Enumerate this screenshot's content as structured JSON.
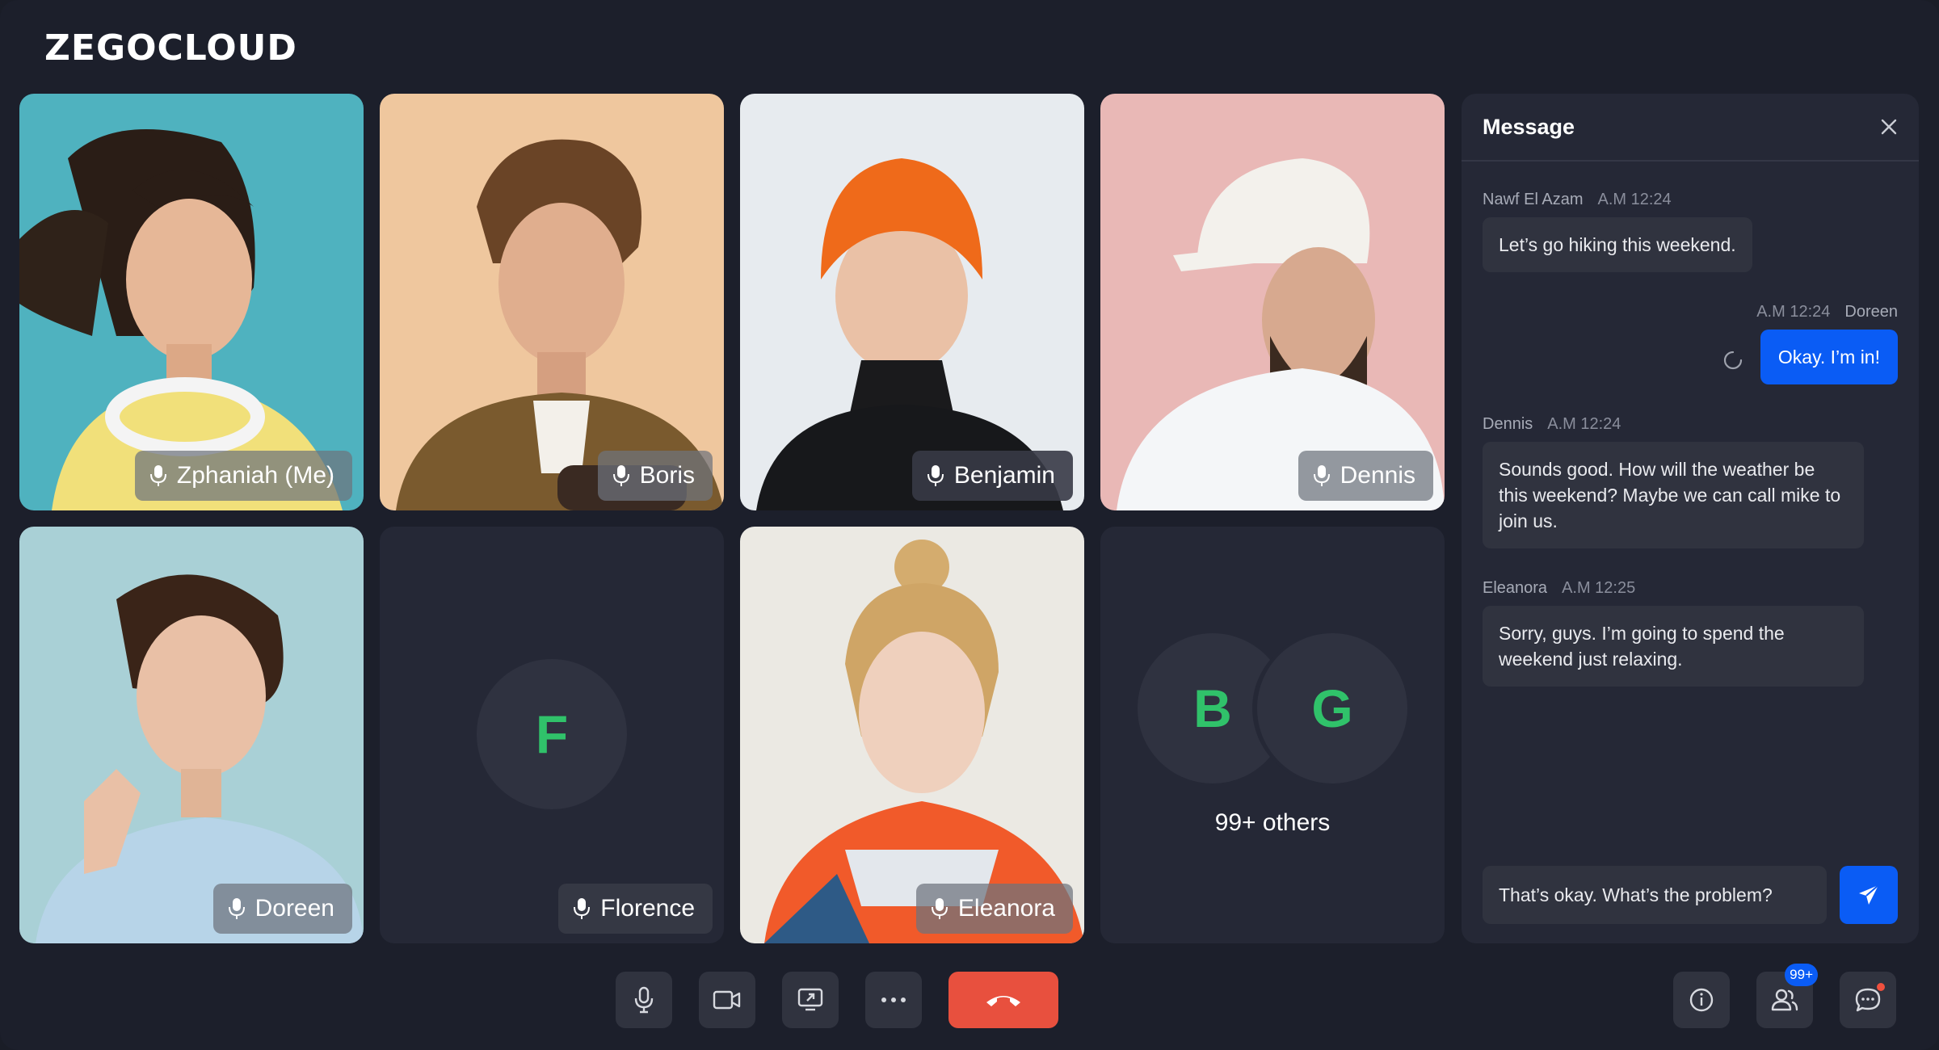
{
  "app": {
    "logo": "ZEGOCLOUD"
  },
  "participants": [
    {
      "name": "Zphaniah (Me)"
    },
    {
      "name": "Boris"
    },
    {
      "name": "Benjamin"
    },
    {
      "name": "Dennis"
    },
    {
      "name": "Doreen"
    },
    {
      "name": "Florence",
      "initial": "F"
    },
    {
      "name": "Eleanora"
    }
  ],
  "others": {
    "initials": [
      "B",
      "G"
    ],
    "label": "99+ others"
  },
  "chat": {
    "title": "Message",
    "messages": [
      {
        "sender": "Nawf El Azam",
        "time": "A.M 12:24",
        "text": "Let’s go hiking this weekend.",
        "mine": false
      },
      {
        "sender": "Doreen",
        "time": "A.M 12:24",
        "text": "Okay. I’m in!",
        "mine": true
      },
      {
        "sender": "Dennis",
        "time": "A.M 12:24",
        "text": "Sounds good. How will the weather be this weekend? Maybe we can call mike to join us.",
        "mine": false
      },
      {
        "sender": "Eleanora",
        "time": "A.M 12:25",
        "text": "Sorry, guys. I’m going to spend the weekend just relaxing.",
        "mine": false
      }
    ],
    "input_value": "That’s okay. What’s the problem?"
  },
  "toolbar": {
    "participants_badge": "99+"
  },
  "colors": {
    "accent": "#0a5cf5",
    "hangup": "#e8503e",
    "initial_green": "#30c26a"
  }
}
